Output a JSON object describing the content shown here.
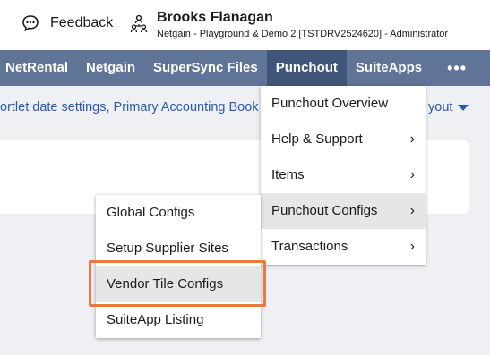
{
  "topbar": {
    "feedback_label": "Feedback",
    "feedback_icon": "chat-bubble-icon",
    "user_icon": "roles-icon",
    "user_name": "Brooks Flanagan",
    "user_role": "Netgain - Playground & Demo 2 [TSTDRV2524620] - Administrator"
  },
  "nav": {
    "items": [
      {
        "label": "NetRental"
      },
      {
        "label": "Netgain"
      },
      {
        "label": "SuperSync Files"
      },
      {
        "label": "Punchout"
      },
      {
        "label": "SuiteApps"
      }
    ],
    "active": "Punchout",
    "more_label": "•••"
  },
  "subbar": {
    "links_text": "ortlet date settings, Primary Accounting Book",
    "layout_text": "yout"
  },
  "punchout_menu": {
    "items": [
      {
        "label": "Punchout Overview",
        "has_submenu": false
      },
      {
        "label": "Help & Support",
        "has_submenu": true
      },
      {
        "label": "Items",
        "has_submenu": true
      },
      {
        "label": "Punchout Configs",
        "has_submenu": true
      },
      {
        "label": "Transactions",
        "has_submenu": true
      }
    ],
    "chevron": "›"
  },
  "configs_submenu": {
    "items": [
      {
        "label": "Global Configs"
      },
      {
        "label": "Setup Supplier Sites"
      },
      {
        "label": "Vendor Tile Configs"
      },
      {
        "label": "SuiteApp Listing"
      }
    ]
  },
  "colors": {
    "navbar": "#5f7496",
    "navbar_active": "#3f5579",
    "link": "#2d5aa8",
    "callout": "#e97a3c",
    "highlight": "#e6e6e6"
  }
}
